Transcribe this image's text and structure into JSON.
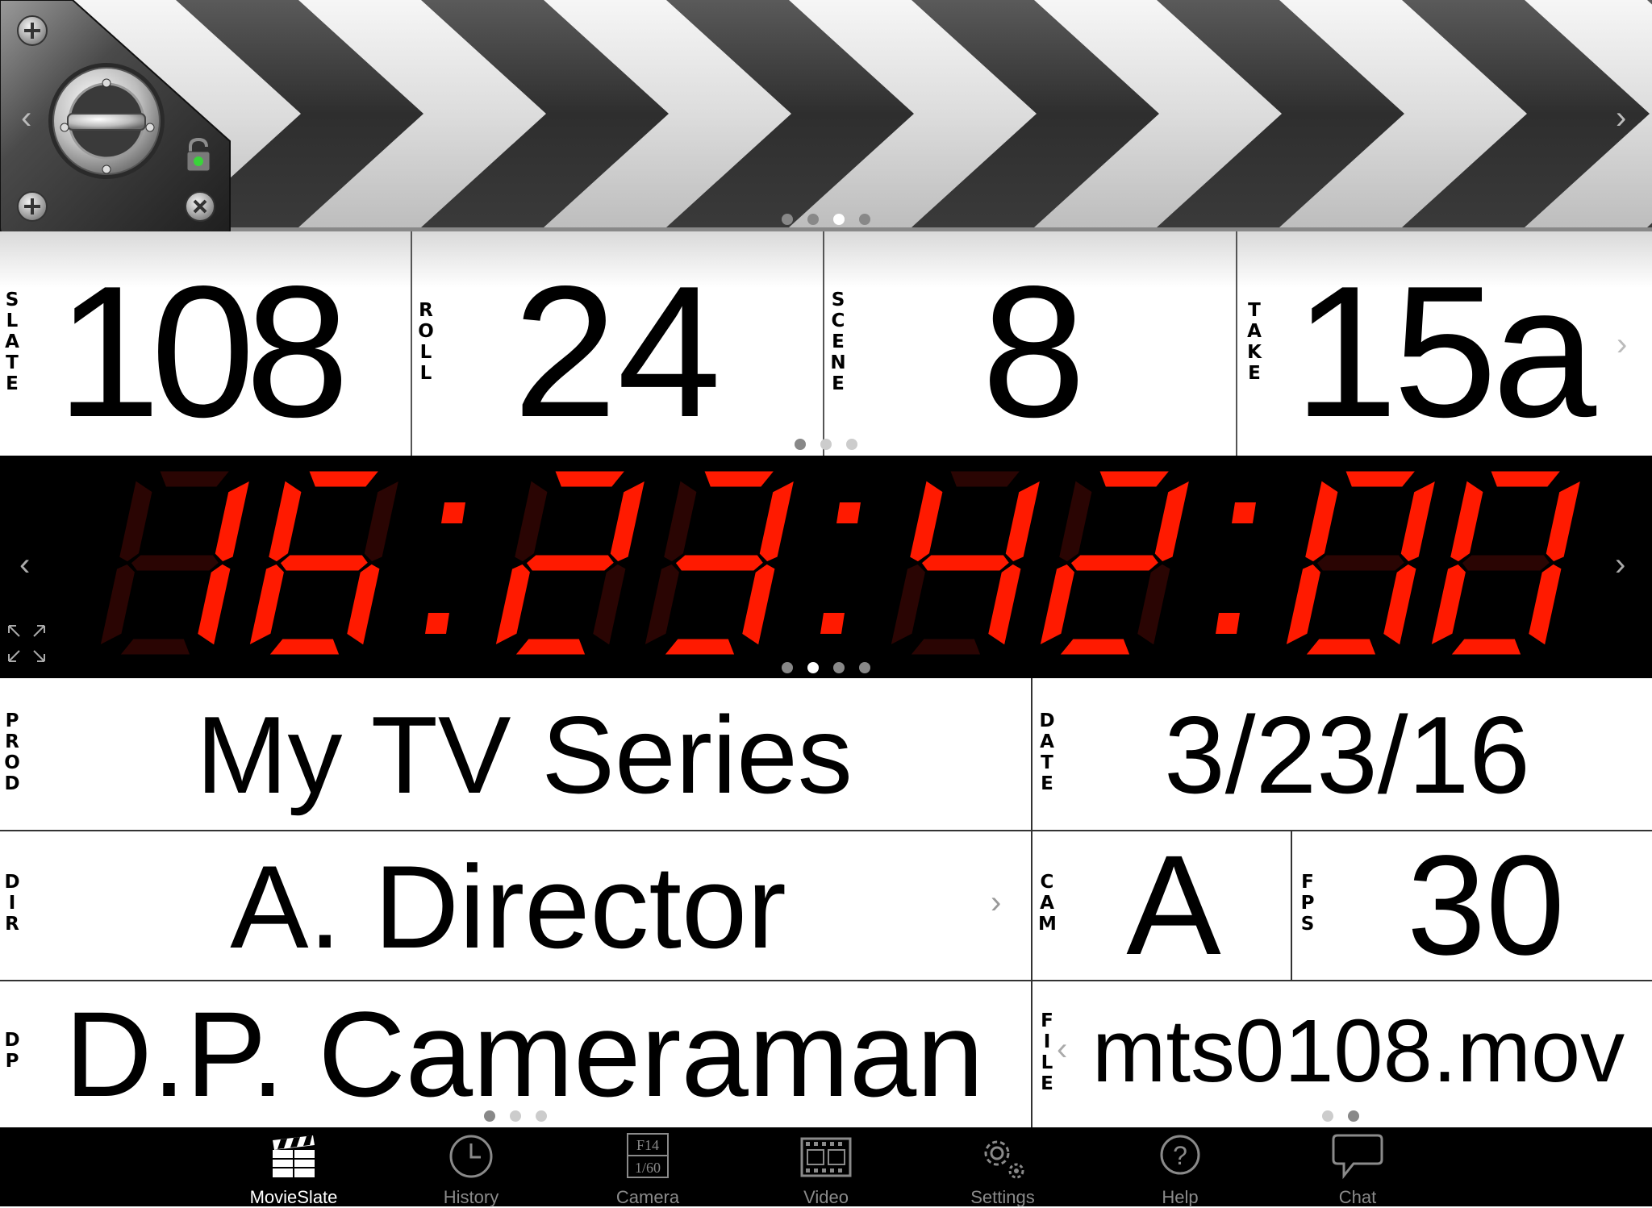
{
  "counters": {
    "slate": {
      "label": "SLATE",
      "value": "108"
    },
    "roll": {
      "label": "ROLL",
      "value": "24"
    },
    "scene": {
      "label": "SCENE",
      "value": "8"
    },
    "take": {
      "label": "TAKE",
      "value": "15a"
    }
  },
  "timecode": {
    "hours": "16",
    "minutes": "23",
    "seconds": "42",
    "frames": "00",
    "color": "#ff1a00"
  },
  "fields": {
    "prod": {
      "label": "PROD",
      "value": "My TV Series"
    },
    "date": {
      "label": "DATE",
      "value": "3/23/16"
    },
    "dir": {
      "label": "DIR",
      "value": "A. Director"
    },
    "cam": {
      "label": "CAM",
      "value": "A"
    },
    "fps": {
      "label": "FPS",
      "value": "30"
    },
    "dp": {
      "label": "DP",
      "value": "D.P. Cameraman"
    },
    "file": {
      "label": "FILE",
      "value": "mts0108.mov"
    }
  },
  "camera_icon": {
    "top": "F14",
    "bottom": "1/60"
  },
  "tabs": [
    {
      "label": "MovieSlate",
      "icon": "clapperboard-icon",
      "active": true
    },
    {
      "label": "History",
      "icon": "clock-icon",
      "active": false
    },
    {
      "label": "Camera",
      "icon": "camera-settings-icon",
      "active": false
    },
    {
      "label": "Video",
      "icon": "film-strip-icon",
      "active": false
    },
    {
      "label": "Settings",
      "icon": "gears-icon",
      "active": false
    },
    {
      "label": "Help",
      "icon": "help-bubble-icon",
      "active": false
    },
    {
      "label": "Chat",
      "icon": "chat-bubble-icon",
      "active": false
    }
  ],
  "page_indicators": {
    "clapper": {
      "count": 4,
      "active": 2
    },
    "counters": {
      "count": 3,
      "active": 0
    },
    "timecode": {
      "count": 4,
      "active": 1
    },
    "left_bottom": {
      "count": 3,
      "active": 0
    },
    "right_bottom": {
      "count": 2,
      "active": 1
    }
  },
  "lock_status": "unlocked",
  "accent_green": "#3ad43a"
}
